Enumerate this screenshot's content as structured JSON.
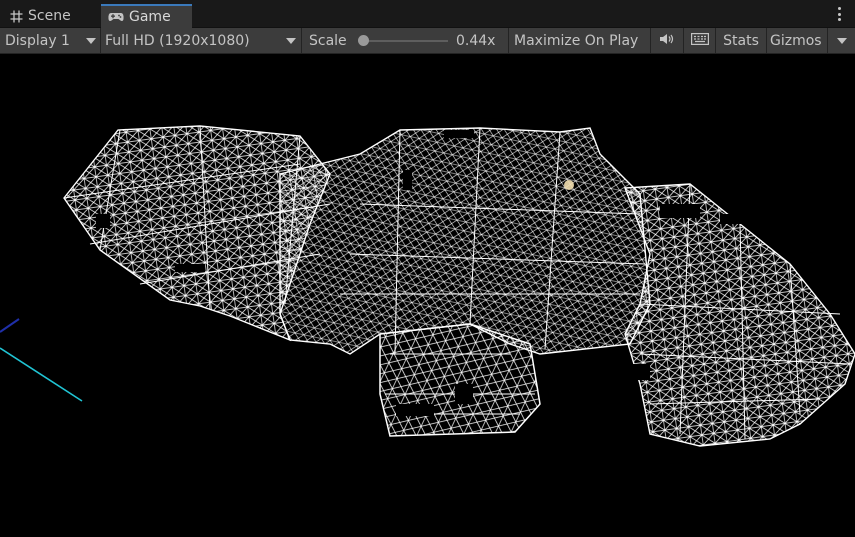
{
  "tabs": {
    "scene": {
      "label": "Scene",
      "icon": "grid-icon"
    },
    "game": {
      "label": "Game",
      "icon": "gamepad-icon",
      "active": true
    }
  },
  "toolbar": {
    "display": "Display 1",
    "resolution": "Full HD (1920x1080)",
    "scale_label": "Scale",
    "scale_value": "0.44x",
    "scale_fraction": 0.0,
    "maximize": "Maximize On Play",
    "audio_icon": "speaker-icon",
    "keyboard_icon": "keyboard-icon",
    "stats": "Stats",
    "gizmos": "Gizmos"
  },
  "colors": {
    "tabbar_bg": "#191919",
    "toolbar_bg": "#3c3c3c",
    "active_tab_accent": "#3a79bb",
    "viewport_bg": "#000000",
    "mesh": "#ffffff",
    "axis_blue": "#1f2fa8",
    "axis_cyan": "#20c4d4",
    "light_gizmo": "#f3dfb0"
  }
}
